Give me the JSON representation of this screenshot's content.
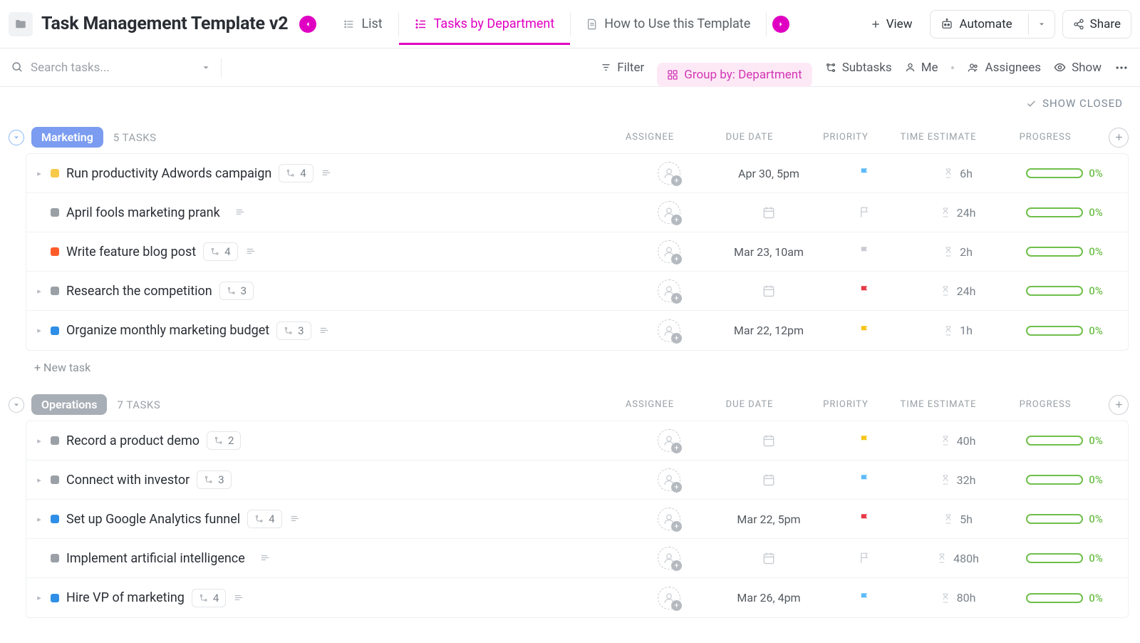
{
  "page": {
    "title": "Task Management Template v2"
  },
  "tabs": {
    "list": "List",
    "dept": "Tasks by Department",
    "howto": "How to Use this Template"
  },
  "topButtons": {
    "view": "View",
    "automate": "Automate",
    "share": "Share"
  },
  "toolbar": {
    "searchPlaceholder": "Search tasks...",
    "filter": "Filter",
    "groupBy": "Group by: Department",
    "subtasks": "Subtasks",
    "me": "Me",
    "assignees": "Assignees",
    "show": "Show"
  },
  "showClosed": "SHOW CLOSED",
  "newTask": "+ New task",
  "columns": {
    "assignee": "ASSIGNEE",
    "due": "DUE DATE",
    "priority": "PRIORITY",
    "time": "TIME ESTIMATE",
    "progress": "PROGRESS"
  },
  "groups": [
    {
      "name": "Marketing",
      "tagClass": "marketing",
      "countLabel": "5 TASKS",
      "collapseClass": "",
      "tasks": [
        {
          "name": "Run productivity Adwords campaign",
          "status": "status-yellow",
          "expand": true,
          "subtasks": "4",
          "desc": true,
          "due": "Apr 30, 5pm",
          "flag": "flag-blue",
          "flagFill": true,
          "time": "6h",
          "progress": "0%"
        },
        {
          "name": "April fools marketing prank",
          "status": "status-gray",
          "expand": false,
          "subtasks": "",
          "desc": true,
          "due": "",
          "flag": "flag-gray",
          "flagFill": false,
          "time": "24h",
          "progress": "0%"
        },
        {
          "name": "Write feature blog post",
          "status": "status-orange",
          "expand": false,
          "subtasks": "4",
          "desc": true,
          "due": "Mar 23, 10am",
          "flag": "flag-gray",
          "flagFill": true,
          "time": "2h",
          "progress": "0%"
        },
        {
          "name": "Research the competition",
          "status": "status-gray",
          "expand": true,
          "subtasks": "3",
          "desc": false,
          "due": "",
          "flag": "flag-red",
          "flagFill": true,
          "time": "24h",
          "progress": "0%"
        },
        {
          "name": "Organize monthly marketing budget",
          "status": "status-blue",
          "expand": true,
          "subtasks": "3",
          "desc": true,
          "due": "Mar 22, 12pm",
          "flag": "flag-yellow",
          "flagFill": true,
          "time": "1h",
          "progress": "0%"
        }
      ]
    },
    {
      "name": "Operations",
      "tagClass": "operations",
      "countLabel": "7 TASKS",
      "collapseClass": "gray",
      "tasks": [
        {
          "name": "Record a product demo",
          "status": "status-gray",
          "expand": true,
          "subtasks": "2",
          "desc": false,
          "due": "",
          "flag": "flag-yellow",
          "flagFill": true,
          "time": "40h",
          "progress": "0%"
        },
        {
          "name": "Connect with investor",
          "status": "status-gray",
          "expand": true,
          "subtasks": "3",
          "desc": false,
          "due": "",
          "flag": "flag-blue",
          "flagFill": true,
          "time": "32h",
          "progress": "0%"
        },
        {
          "name": "Set up Google Analytics funnel",
          "status": "status-blue",
          "expand": true,
          "subtasks": "4",
          "desc": true,
          "due": "Mar 22, 5pm",
          "flag": "flag-red",
          "flagFill": true,
          "time": "5h",
          "progress": "0%"
        },
        {
          "name": "Implement artificial intelligence",
          "status": "status-gray",
          "expand": false,
          "subtasks": "",
          "desc": true,
          "due": "",
          "flag": "flag-gray",
          "flagFill": false,
          "time": "480h",
          "progress": "0%"
        },
        {
          "name": "Hire VP of marketing",
          "status": "status-blue",
          "expand": true,
          "subtasks": "4",
          "desc": true,
          "due": "Mar 26, 4pm",
          "flag": "flag-blue",
          "flagFill": true,
          "time": "80h",
          "progress": "0%"
        }
      ]
    }
  ]
}
